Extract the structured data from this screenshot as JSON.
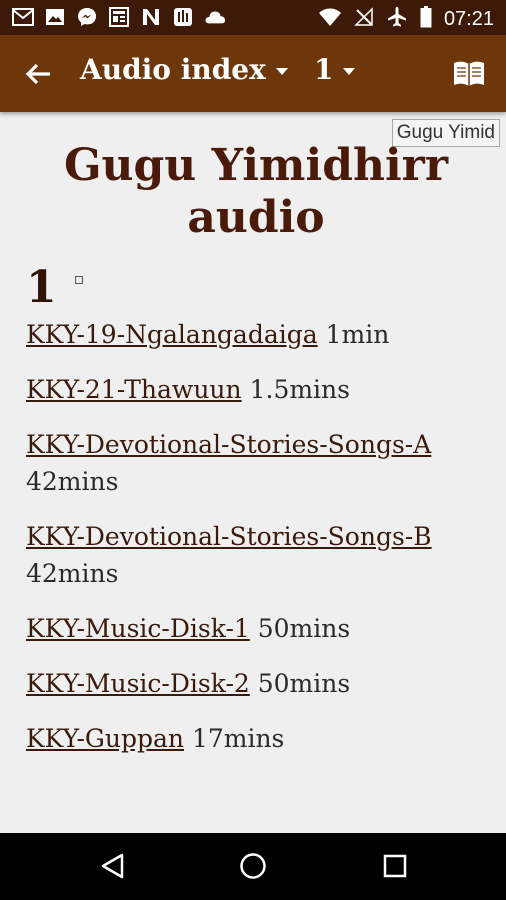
{
  "status_bar": {
    "time": "07:21",
    "icons": [
      "gmail-icon",
      "image-icon",
      "messenger-icon",
      "news-icon",
      "n-icon",
      "app-icon",
      "cloud-icon",
      "wifi-icon",
      "no-sim-icon",
      "airplane-icon",
      "battery-icon"
    ]
  },
  "app_bar": {
    "title": "Audio index",
    "chapter": "1",
    "back_icon": "arrow-back-icon",
    "book_icon": "open-book-icon"
  },
  "watermark": "Gugu Yimid",
  "page": {
    "heading": "Gugu Yimidhirr audio",
    "section_number": "1",
    "entries": [
      {
        "link": "KKY-19-Ngalangadaiga",
        "duration": "1min"
      },
      {
        "link": "KKY-21-Thawuun",
        "duration": "1.5mins"
      },
      {
        "link": "KKY-Devotional-Stories-Songs-A",
        "duration": "42mins"
      },
      {
        "link": "KKY-Devotional-Stories-Songs-B",
        "duration": "42mins"
      },
      {
        "link": "KKY-Music-Disk-1",
        "duration": "50mins"
      },
      {
        "link": "KKY-Music-Disk-2",
        "duration": "50mins"
      },
      {
        "link": "KKY-Guppan",
        "duration": "17mins"
      }
    ]
  },
  "nav_bar": [
    "back-triangle-icon",
    "home-circle-icon",
    "recents-square-icon"
  ]
}
